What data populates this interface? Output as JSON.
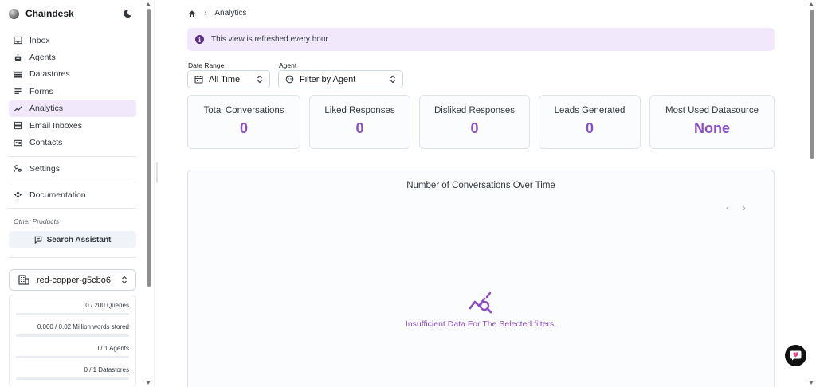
{
  "sidebar": {
    "brand": "Chaindesk",
    "items": [
      {
        "label": "Inbox",
        "icon": "inbox-icon"
      },
      {
        "label": "Agents",
        "icon": "robot-icon"
      },
      {
        "label": "Datastores",
        "icon": "list-icon"
      },
      {
        "label": "Forms",
        "icon": "forms-icon"
      },
      {
        "label": "Analytics",
        "icon": "trending-icon",
        "active": true
      },
      {
        "label": "Email Inboxes",
        "icon": "email-inbox-icon"
      },
      {
        "label": "Contacts",
        "icon": "contacts-icon"
      }
    ],
    "settings_label": "Settings",
    "documentation_label": "Documentation",
    "other_products_label": "Other Products",
    "search_assistant_label": "Search Assistant",
    "org_name": "red-copper-g5cbo6",
    "usage": {
      "queries": "0 / 200 Queries",
      "words": "0.000 / 0.02 Million words stored",
      "agents": "0 / 1 Agents",
      "datastores": "0 / 1 Datastores"
    }
  },
  "breadcrumb": {
    "current": "Analytics",
    "separator": "›"
  },
  "alert": {
    "text": "This view is refreshed every hour",
    "icon_char": "i"
  },
  "filters": {
    "date_range_label": "Date Range",
    "date_range_value": "All Time",
    "agent_label": "Agent",
    "agent_placeholder": "Filter by Agent"
  },
  "stats": [
    {
      "title": "Total Conversations",
      "value": "0"
    },
    {
      "title": "Liked Responses",
      "value": "0"
    },
    {
      "title": "Disliked Responses",
      "value": "0"
    },
    {
      "title": "Leads Generated",
      "value": "0"
    },
    {
      "title": "Most Used Datasource",
      "value": "None"
    }
  ],
  "chart": {
    "title": "Number of Conversations Over Time",
    "prev_char": "‹",
    "next_char": "›",
    "empty_text": "Insufficient Data For The Selected filters."
  },
  "colors": {
    "accent": "#8a4fc4",
    "active_bg": "#f2e8fb",
    "alert_icon": "#5a2b86"
  }
}
